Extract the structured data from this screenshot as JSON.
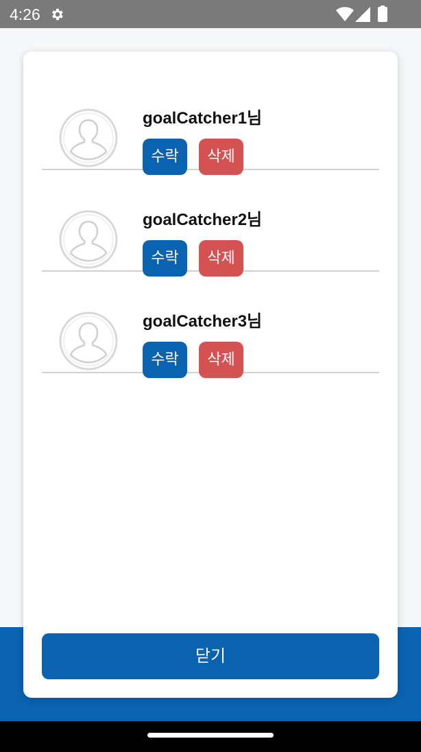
{
  "status_bar": {
    "time": "4:26",
    "icons": [
      "gear-icon",
      "wifi-icon",
      "signal-icon",
      "battery-icon"
    ]
  },
  "friend_requests": [
    {
      "username": "goalCatcher1님",
      "accept_label": "수락",
      "delete_label": "삭제"
    },
    {
      "username": "goalCatcher2님",
      "accept_label": "수락",
      "delete_label": "삭제"
    },
    {
      "username": "goalCatcher3님",
      "accept_label": "수락",
      "delete_label": "삭제"
    }
  ],
  "close_label": "닫기",
  "colors": {
    "primary": "#0a63b0",
    "danger": "#d55252",
    "status_bar": "#7a7a7a"
  }
}
